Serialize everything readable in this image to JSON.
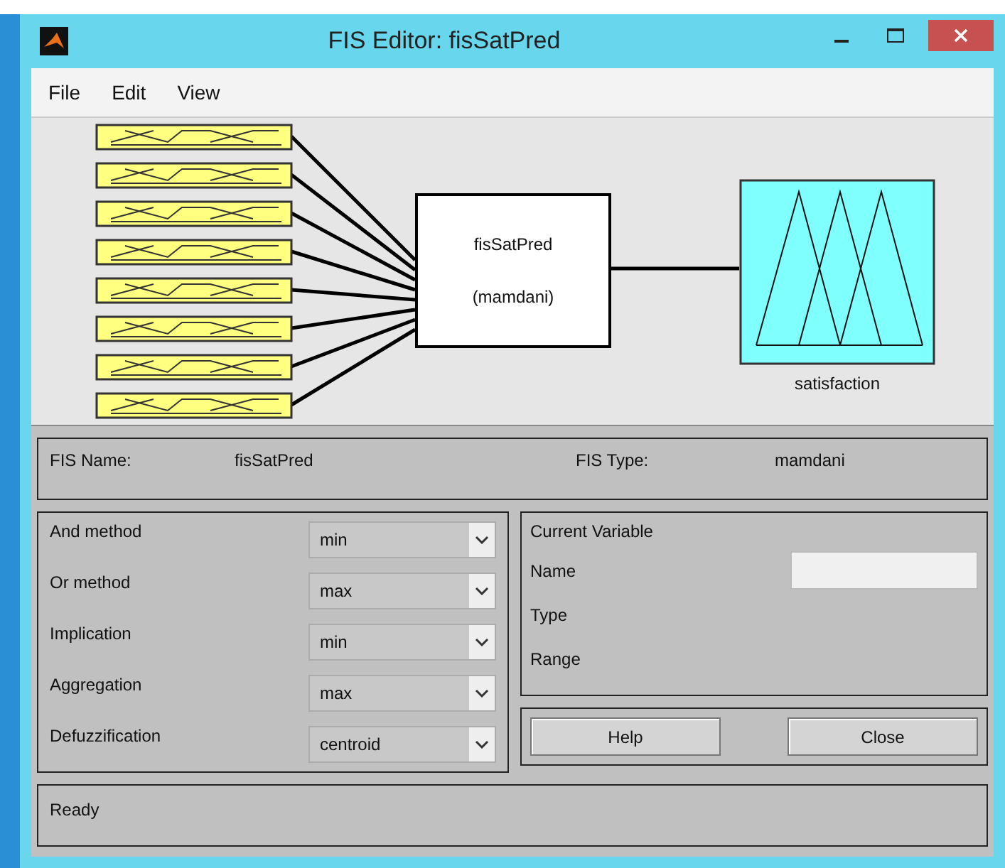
{
  "window": {
    "title": "FIS Editor: fisSatPred"
  },
  "menu": [
    "File",
    "Edit",
    "View"
  ],
  "diagram": {
    "system_name": "fisSatPred",
    "system_type": "(mamdani)",
    "output": "satisfaction"
  },
  "info": [
    {
      "label": "FIS Name:",
      "value": "fisSatPred"
    },
    {
      "label": "FIS Type:",
      "value": "mamdani"
    }
  ],
  "methods": [
    {
      "label": "And method",
      "value": "min"
    },
    {
      "label": "Or method",
      "value": "max"
    },
    {
      "label": "Implication",
      "value": "min"
    },
    {
      "label": "Aggregation",
      "value": "max"
    },
    {
      "label": "Defuzzification",
      "value": "centroid"
    }
  ],
  "current_variable": {
    "title": "Current Variable",
    "fields": [
      {
        "label": "Name",
        "kind": "input"
      },
      {
        "label": "Type",
        "kind": "text"
      },
      {
        "label": "Range",
        "kind": "text"
      }
    ]
  },
  "buttons": [
    "Help",
    "Close"
  ],
  "status": "Ready"
}
